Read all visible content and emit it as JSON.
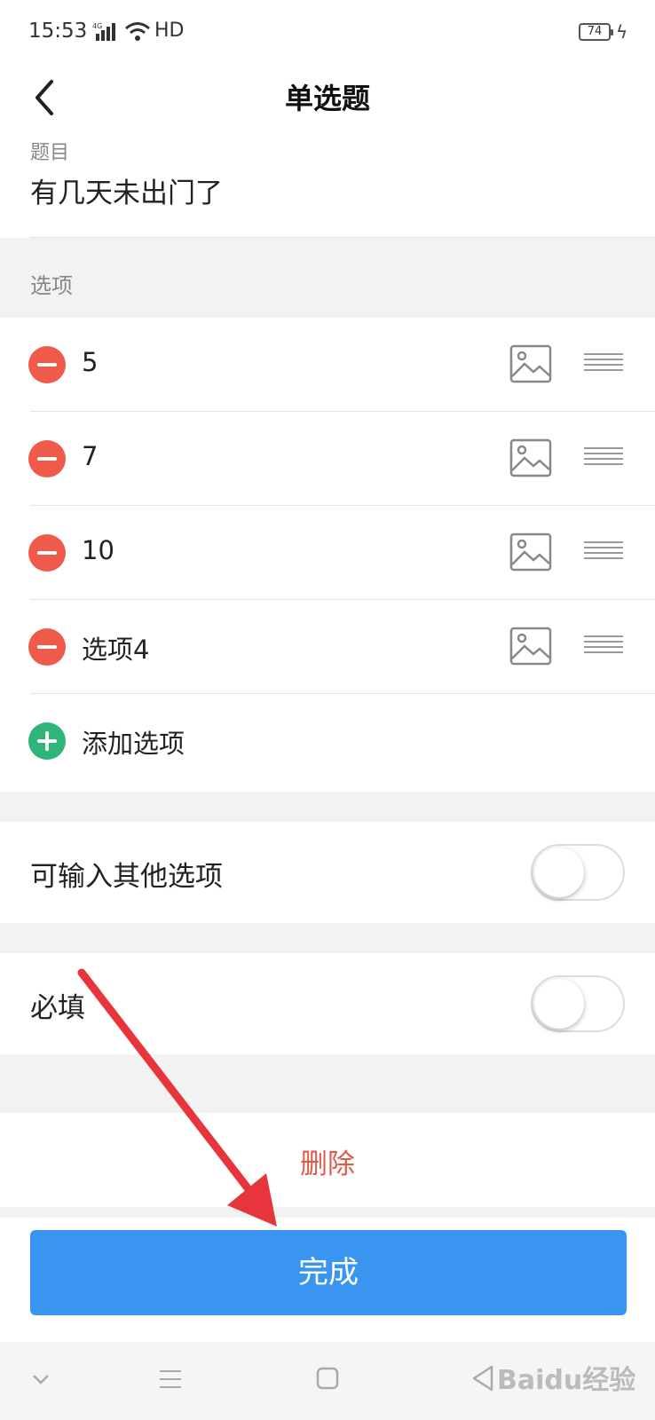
{
  "status_bar": {
    "time": "15:53",
    "network": "4G",
    "hd": "HD",
    "battery": "74"
  },
  "header": {
    "title": "单选题"
  },
  "question": {
    "label": "题目",
    "text": "有几天未出门了"
  },
  "options_header": "选项",
  "options": [
    {
      "label": "5"
    },
    {
      "label": "7"
    },
    {
      "label": "10"
    },
    {
      "label": "选项4"
    }
  ],
  "add_option": "添加选项",
  "toggles": {
    "other_input": {
      "label": "可输入其他选项",
      "on": false
    },
    "required": {
      "label": "必填",
      "on": false
    }
  },
  "delete_label": "删除",
  "done_label": "完成",
  "watermark": "Baidu经验",
  "colors": {
    "accent": "#3a95f1",
    "delete": "#e05a4a",
    "minus": "#ef5a4a",
    "plus": "#2fb47a",
    "annotation_arrow": "#e8353b"
  }
}
